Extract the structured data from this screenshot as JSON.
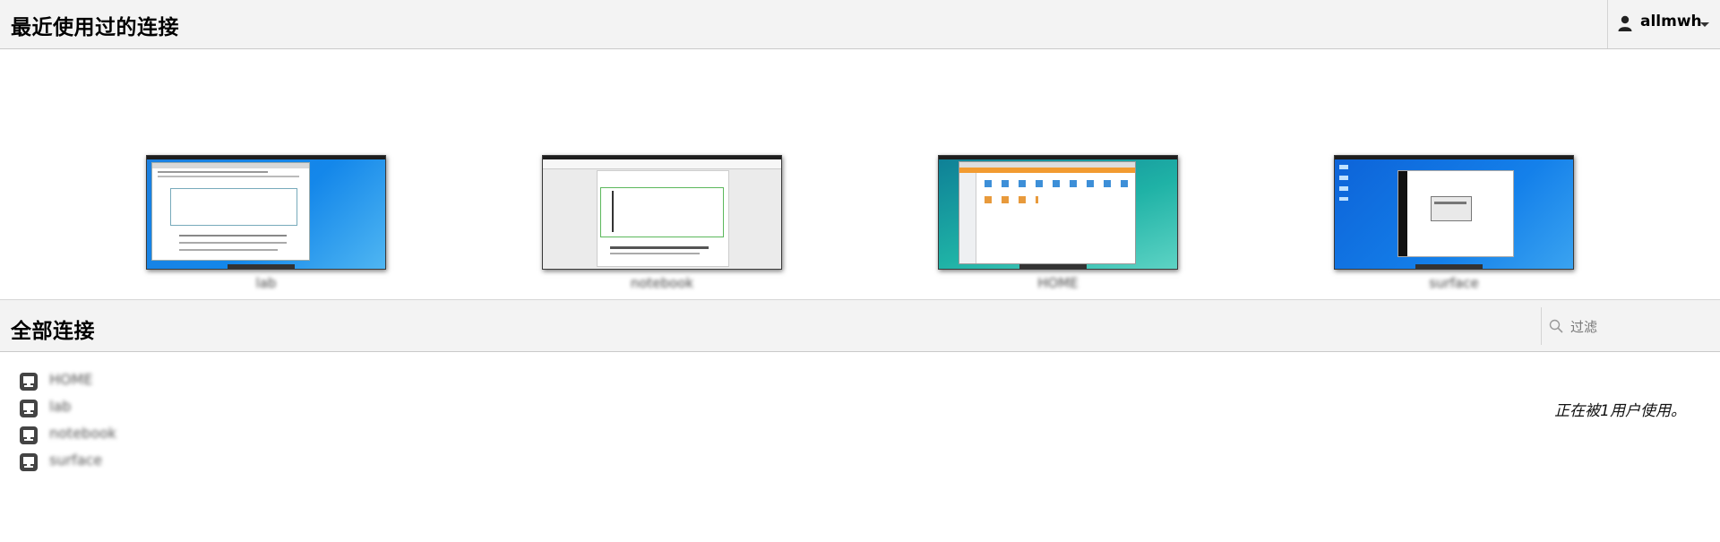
{
  "header": {
    "title": "最近使用过的连接",
    "username": "allmwh"
  },
  "recent": [
    {
      "name": "lab",
      "wallpaper": "#1a7fe0"
    },
    {
      "name": "notebook",
      "wallpaper": "#ebebeb"
    },
    {
      "name": "HOME",
      "wallpaper": "#1aa79f"
    },
    {
      "name": "surface",
      "wallpaper": "#0f6fe0"
    }
  ],
  "all_connections": {
    "title": "全部连接",
    "filter_placeholder": "过滤",
    "items": [
      {
        "name": "HOME",
        "active_status": ""
      },
      {
        "name": "lab",
        "active_status": "正在被1用户使用。"
      },
      {
        "name": "notebook",
        "active_status": ""
      },
      {
        "name": "surface",
        "active_status": ""
      }
    ]
  },
  "colors": {
    "header_bg": "#f3f3f3",
    "border": "#c9c9c9",
    "icon": "#444444"
  },
  "icons": {
    "user": "user-icon",
    "dropdown": "chevron-down-icon",
    "search": "search-icon",
    "connection": "monitor-icon"
  }
}
